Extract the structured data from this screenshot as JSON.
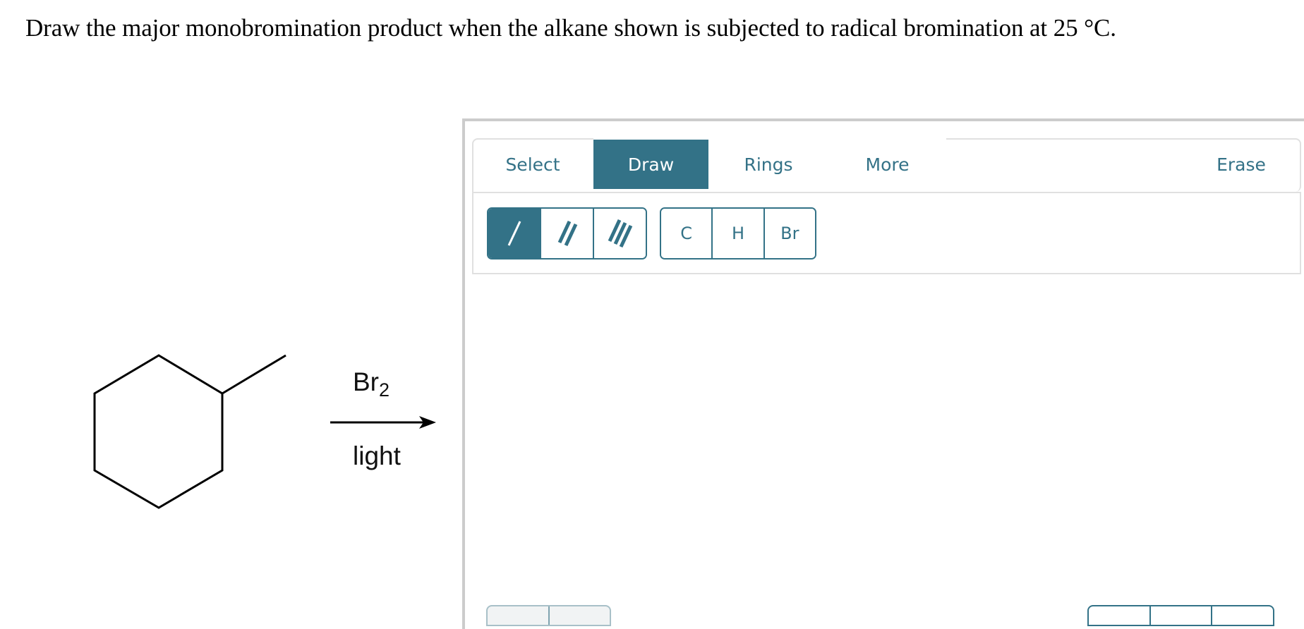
{
  "question": {
    "text": "Draw the major monobromination product when the alkane shown is subjected to radical bromination at 25 °C."
  },
  "reaction": {
    "reactant": "methylcyclohexane",
    "reagent_top": "Br",
    "reagent_top_subscript": "2",
    "reagent_bottom": "light",
    "arrow": "right-arrow"
  },
  "editor": {
    "tabs": [
      {
        "label": "Select",
        "active": false
      },
      {
        "label": "Draw",
        "active": true
      },
      {
        "label": "Rings",
        "active": false
      },
      {
        "label": "More",
        "active": false
      },
      {
        "label": "Erase",
        "active": false
      }
    ],
    "bond_tools": [
      {
        "name": "single-bond",
        "active": true
      },
      {
        "name": "double-bond",
        "active": false
      },
      {
        "name": "triple-bond",
        "active": false
      }
    ],
    "atom_tools": [
      "C",
      "H",
      "Br"
    ]
  },
  "colors": {
    "accent": "#337287",
    "border": "#e0e0e0",
    "frame": "#cccccc"
  }
}
